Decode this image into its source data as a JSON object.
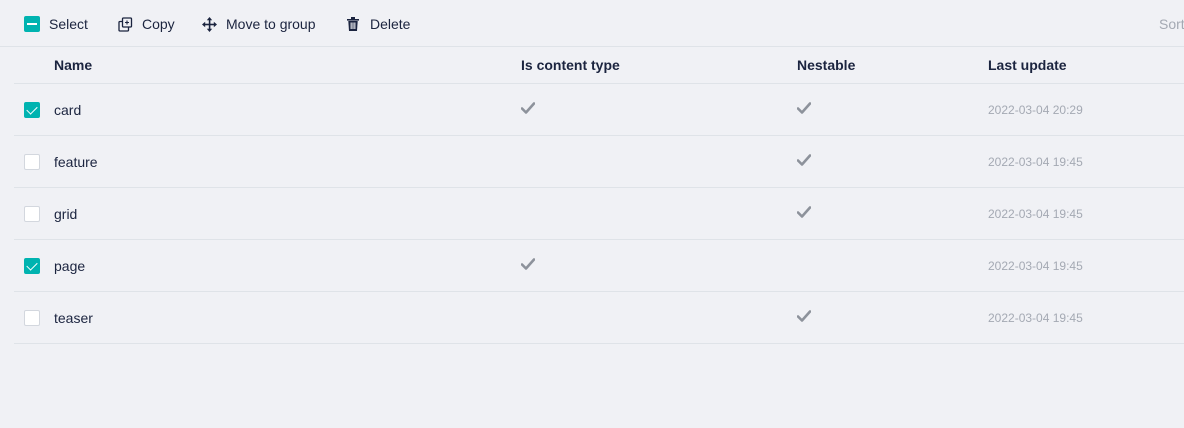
{
  "toolbar": {
    "select_label": "Select",
    "copy_label": "Copy",
    "move_label": "Move to group",
    "delete_label": "Delete",
    "sort_label": "Sort"
  },
  "table": {
    "columns": {
      "name": "Name",
      "is_content_type": "Is content type",
      "nestable": "Nestable",
      "last_update": "Last update"
    },
    "rows": [
      {
        "name": "card",
        "selected": true,
        "is_content_type": true,
        "nestable": true,
        "last_update": "2022-03-04 20:29"
      },
      {
        "name": "feature",
        "selected": false,
        "is_content_type": false,
        "nestable": true,
        "last_update": "2022-03-04 19:45"
      },
      {
        "name": "grid",
        "selected": false,
        "is_content_type": false,
        "nestable": true,
        "last_update": "2022-03-04 19:45"
      },
      {
        "name": "page",
        "selected": true,
        "is_content_type": true,
        "nestable": false,
        "last_update": "2022-03-04 19:45"
      },
      {
        "name": "teaser",
        "selected": false,
        "is_content_type": false,
        "nestable": true,
        "last_update": "2022-03-04 19:45"
      }
    ]
  },
  "colors": {
    "accent": "#00b3b0",
    "text": "#1b243f",
    "muted": "#a4a9b3",
    "background": "#f0f1f5",
    "border": "#dfe3e8"
  },
  "icons": {
    "select": "minus-checkbox-icon",
    "copy": "copy-icon",
    "move": "move-arrows-icon",
    "delete": "trash-icon",
    "flag": "check-icon"
  }
}
